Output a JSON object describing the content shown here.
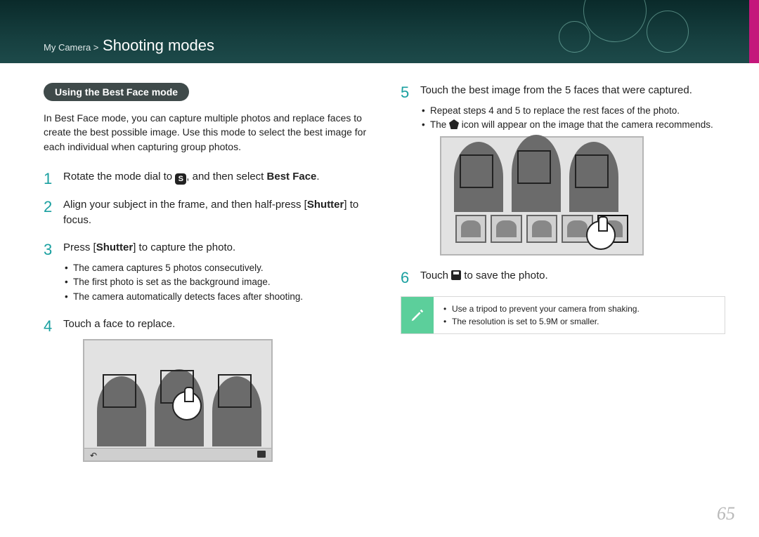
{
  "breadcrumb": {
    "parent": "My Camera >",
    "title": "Shooting modes"
  },
  "section_pill": "Using the Best Face mode",
  "intro": "In Best Face mode, you can capture multiple photos and replace faces to create the best possible image. Use this mode to select the best image for each individual when capturing group photos.",
  "steps": {
    "s1_pre": "Rotate the mode dial to ",
    "s1_icon": "S",
    "s1_post": ", and then select ",
    "s1_bold": "Best Face",
    "s1_end": ".",
    "s2_pre": "Align your subject in the frame, and then half-press [",
    "s2_bold": "Shutter",
    "s2_post": "] to focus.",
    "s3_pre": "Press [",
    "s3_bold": "Shutter",
    "s3_post": "] to capture the photo.",
    "s3_bullets": [
      "The camera captures 5 photos consecutively.",
      "The first photo is set as the background image.",
      "The camera automatically detects faces after shooting."
    ],
    "s4": "Touch a face to replace.",
    "s5": "Touch the best image from the 5 faces that were captured.",
    "s5_bullets_a": "Repeat steps 4 and 5 to replace the rest faces of the photo.",
    "s5_bullets_b_pre": "The ",
    "s5_bullets_b_post": " icon will appear on the image that the camera recommends.",
    "s6_pre": "Touch ",
    "s6_post": " to save the photo."
  },
  "note": [
    "Use a tripod to prevent your camera from shaking.",
    "The resolution is set to 5.9M or smaller."
  ],
  "page_number": "65"
}
